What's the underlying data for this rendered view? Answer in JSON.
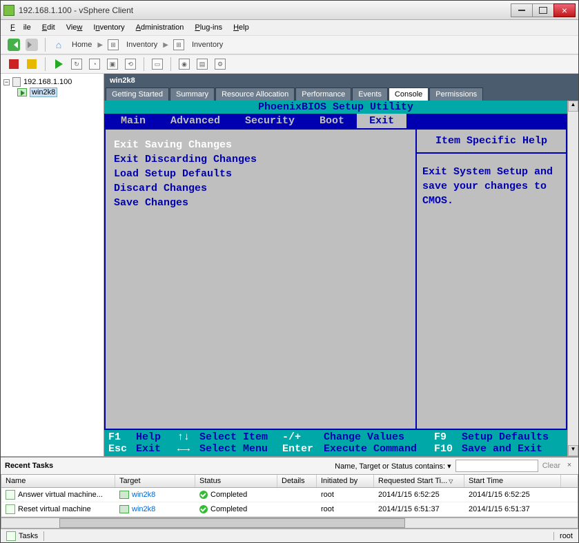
{
  "window": {
    "title": "192.168.1.100 - vSphere Client"
  },
  "menu": {
    "file": "File",
    "edit": "Edit",
    "view": "View",
    "inventory": "Inventory",
    "admin": "Administration",
    "plugins": "Plug-ins",
    "help": "Help"
  },
  "breadcrumb": {
    "home": "Home",
    "inv1": "Inventory",
    "inv2": "Inventory"
  },
  "tree": {
    "host": "192.168.1.100",
    "vm": "win2k8"
  },
  "vm": {
    "title": "win2k8",
    "tabs": {
      "getting_started": "Getting Started",
      "summary": "Summary",
      "resource": "Resource Allocation",
      "performance": "Performance",
      "events": "Events",
      "console": "Console",
      "permissions": "Permissions"
    }
  },
  "bios": {
    "title": "PhoenixBIOS Setup Utility",
    "menu": {
      "main": "Main",
      "advanced": "Advanced",
      "security": "Security",
      "boot": "Boot",
      "exit": "Exit"
    },
    "options": [
      "Exit Saving Changes",
      "Exit Discarding Changes",
      "Load Setup Defaults",
      "Discard Changes",
      "Save Changes"
    ],
    "help_title": "Item Specific Help",
    "help_text": "Exit System Setup and save your changes to CMOS.",
    "foot": {
      "f1": "F1",
      "help": "Help",
      "ud": "↑↓",
      "select_item": "Select Item",
      "pm": "-/+",
      "change_values": "Change Values",
      "f9": "F9",
      "setup_defaults": "Setup Defaults",
      "esc": "Esc",
      "exit": "Exit",
      "lr": "←→",
      "select_menu": "Select Menu",
      "enter": "Enter",
      "execute": "Execute Command",
      "f10": "F10",
      "save_exit": "Save and Exit"
    }
  },
  "tasks": {
    "title": "Recent Tasks",
    "filter_label": "Name, Target or Status contains: ▾",
    "clear": "Clear",
    "columns": {
      "name": "Name",
      "target": "Target",
      "status": "Status",
      "details": "Details",
      "init": "Initiated by",
      "req": "Requested Start Ti...",
      "start": "Start Time"
    },
    "rows": [
      {
        "name": "Answer virtual machine...",
        "target": "win2k8",
        "status": "Completed",
        "details": "",
        "init": "root",
        "req": "2014/1/15 6:52:25",
        "start": "2014/1/15 6:52:25"
      },
      {
        "name": "Reset virtual machine",
        "target": "win2k8",
        "status": "Completed",
        "details": "",
        "init": "root",
        "req": "2014/1/15 6:51:37",
        "start": "2014/1/15 6:51:37"
      }
    ]
  },
  "status": {
    "tasks": "Tasks",
    "user": "root"
  }
}
